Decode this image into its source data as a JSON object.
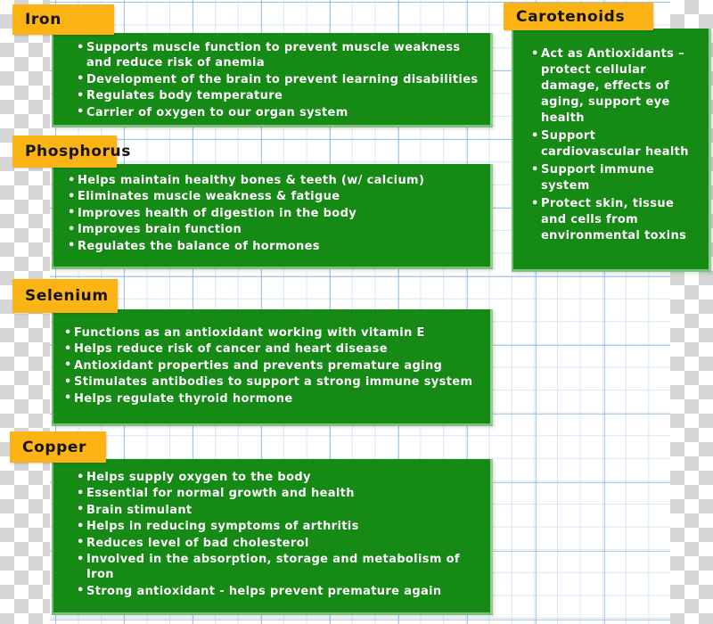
{
  "palette": {
    "panel_green": "#158A15",
    "tab_orange": "#FCB414",
    "text_white": "#FFFFFF",
    "tab_text": "#141414",
    "grid_blue": "#78AAE1",
    "page_white": "#FFFFFF"
  },
  "sections": [
    {
      "id": "iron",
      "title": "Iron",
      "bullets": [
        "Supports muscle function to prevent muscle weakness and reduce risk of anemia",
        "Development of the brain to prevent learning disabilities",
        "Regulates body temperature",
        "Carrier of oxygen to our organ system"
      ]
    },
    {
      "id": "phosphorus",
      "title": "Phosphorus",
      "bullets": [
        "Helps maintain healthy bones & teeth (w/ calcium)",
        "Eliminates muscle weakness & fatigue",
        "Improves health of digestion in the body",
        "Improves brain function",
        "Regulates the balance of hormones"
      ]
    },
    {
      "id": "selenium",
      "title": "Selenium",
      "bullets": [
        "Functions as an antioxidant working with vitamin E",
        "Helps reduce risk of cancer and heart disease",
        "Antioxidant properties and prevents premature aging",
        "Stimulates antibodies to support a strong immune system",
        "Helps regulate thyroid hormone"
      ]
    },
    {
      "id": "copper",
      "title": "Copper",
      "bullets": [
        "Helps supply oxygen to the body",
        "Essential for normal growth and health",
        "Brain stimulant",
        "Helps in reducing symptoms of arthritis",
        "Reduces level of bad cholesterol",
        "Involved in the absorption, storage and metabolism of Iron",
        "Strong antioxidant - helps prevent premature again"
      ]
    },
    {
      "id": "carotenoids",
      "title": "Carotenoids",
      "bullets": [
        "Act as Antioxidants – protect cellular damage, effects of aging,  support eye health",
        "Support cardiovascular health",
        "Support immune system",
        "Protect skin, tissue and cells from environmental toxins"
      ]
    }
  ]
}
